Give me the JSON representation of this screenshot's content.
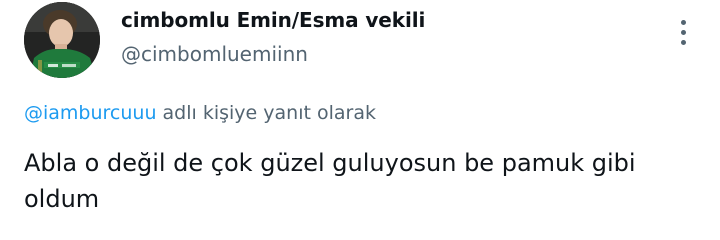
{
  "author": {
    "display_name": "cimbomlu Emin/Esma vekili",
    "handle": "@cimbomluemiinn",
    "avatar_icon": "profile-photo"
  },
  "reply_context": {
    "mention": "@iamburcuuu",
    "suffix": " adlı kişiye yanıt olarak"
  },
  "tweet": {
    "text": "Abla o değil de çok güzel guluyosun be pamuk gibi oldum"
  },
  "menu": {
    "icon": "more-vertical-icon"
  },
  "colors": {
    "text_primary": "#0f1419",
    "text_secondary": "#536471",
    "link": "#1d9bf0",
    "background": "#ffffff"
  }
}
